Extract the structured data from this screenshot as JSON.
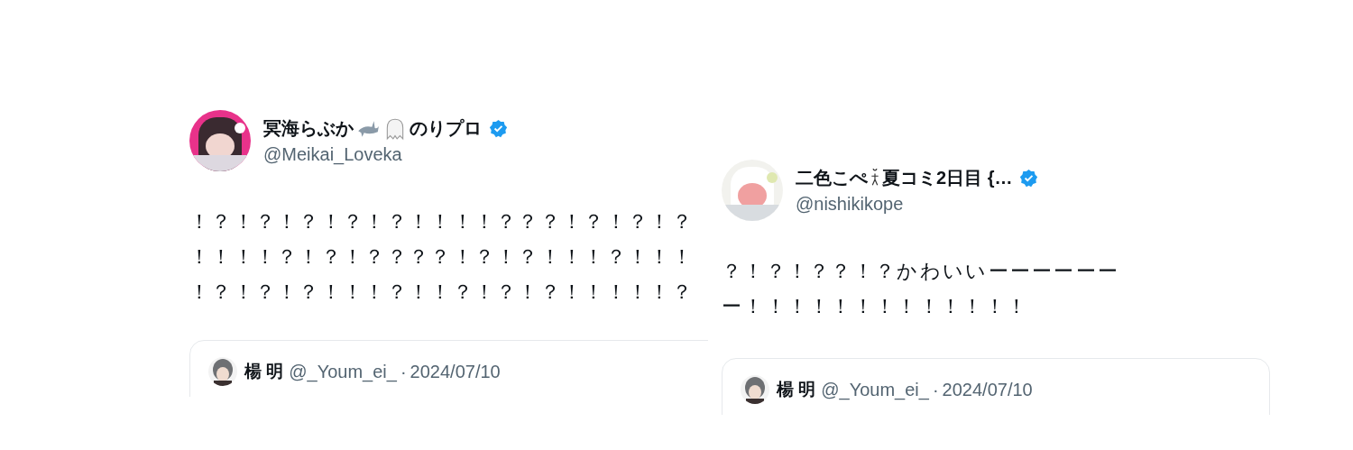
{
  "posts": [
    {
      "name_parts": [
        {
          "kind": "text",
          "text": "冥海らぶか"
        },
        {
          "kind": "shark"
        },
        {
          "kind": "ghost"
        },
        {
          "kind": "text",
          "text": "のりプロ"
        }
      ],
      "verified": true,
      "handle": "@Meikai_Loveka",
      "body": "！？！？！？！？！？！！！！？？？！？！？！？！！！！？！？！？？？？！？！？！！！？！！！！？！？！？！！！？！！？！？！？！！！！！？",
      "quote": {
        "name": "楊 明",
        "handle": "@_Youm_ei_",
        "separator": "·",
        "date": "2024/07/10"
      }
    },
    {
      "name_parts": [
        {
          "kind": "text",
          "text": "二色こぺ"
        },
        {
          "kind": "figure"
        },
        {
          "kind": "text",
          "text": "夏コミ2日目 {…"
        }
      ],
      "verified": true,
      "handle": "@nishikikope",
      "body": "？！？！？？！？かわいいーーーーーーー！！！！！！！！！！！！！",
      "quote": {
        "name": "楊 明",
        "handle": "@_Youm_ei_",
        "separator": "·",
        "date": "2024/07/10"
      }
    }
  ]
}
